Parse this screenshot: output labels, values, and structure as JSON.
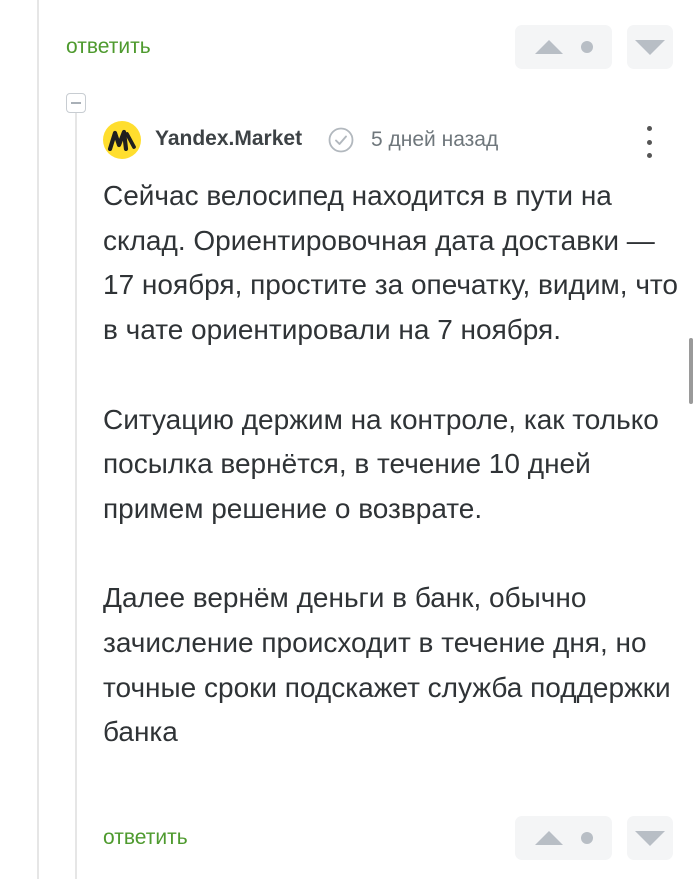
{
  "top_actions": {
    "reply_label": "ответить"
  },
  "comment": {
    "author": "Yandex.Market",
    "timestamp": "5 дней назад",
    "paragraphs": [
      "Сейчас велосипед находится в пути на склад. Ориентировочная дата доставки — 17 ноября, простите за опечатку, видим, что в чате ориентировали на 7 ноября.",
      "Ситуацию держим на контроле, как только посылка вернётся, в течение 10 дней примем решение о возврате.",
      "Далее вернём деньги в банк, обычно зачисление происходит в течение дня, но точные сроки подскажет служба поддержки банка"
    ],
    "reply_label": "ответить"
  },
  "icons": {
    "upvote": "arrow-up-icon",
    "neutral": "dot-icon",
    "downvote": "arrow-down-icon",
    "verified": "check-circle-icon",
    "more": "more-vertical-icon",
    "collapse": "minus-square-icon"
  },
  "colors": {
    "accent": "#4e9a2e",
    "vote_bg": "#f4f5f6",
    "vote_icon": "#b8bec5",
    "avatar_bg": "#ffde2e"
  }
}
